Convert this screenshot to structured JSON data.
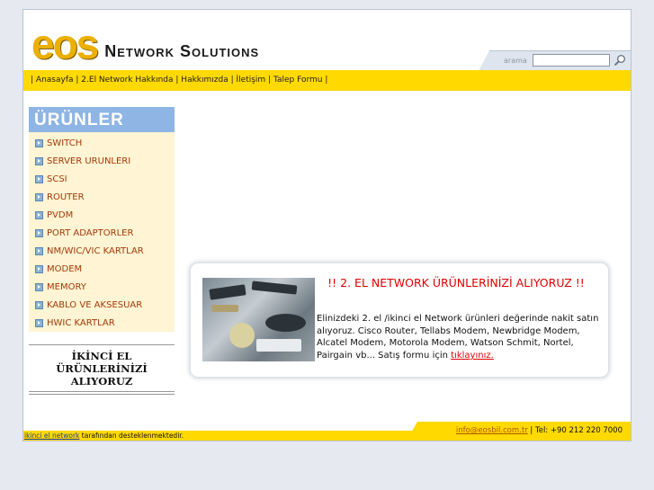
{
  "logo": {
    "primary": "eos",
    "secondary": "Network Solutions"
  },
  "search": {
    "label": "arama",
    "placeholder": "",
    "value": ""
  },
  "nav": {
    "separator_start": "|",
    "items": [
      "Anasayfa",
      "2.El Network Hakkında",
      "Hakkımızda",
      "İletişim",
      "Talep Formu"
    ],
    "separator": " | ",
    "separator_end": "|"
  },
  "sidebar": {
    "title": "ÜRÜNLER",
    "items": [
      "SWITCH",
      "SERVER URUNLERI",
      "SCSI",
      "ROUTER",
      "PVDM",
      "PORT ADAPTORLER",
      "NM/WIC/VIC KARTLAR",
      "MODEM",
      "MEMORY",
      "KABLO VE AKSESUAR",
      "HWIC KARTLAR"
    ],
    "promo": "İKİNCİ EL ÜRÜNLERİNİZİ ALIYORUZ"
  },
  "promo": {
    "heading": "!! 2. EL NETWORK ÜRÜNLERİNİZİ ALIYORUZ !!",
    "text": "Elinizdeki 2. el /ikinci el Network ürünleri değerinde nakit satın alıyoruz. Cisco Router, Tellabs Modem, Newbridge Modem, Alcatel Modem, Motorola Modem, Watson Schmit, Nortel, Pairgain vb... Satış formu için",
    "link": "tıklayınız."
  },
  "footer": {
    "email": "info@eosbil.com.tr",
    "phone_sep": "| Tel: +90 212 220 7000",
    "link": "ikinci el network",
    "tagline": "tarafından desteklenmektedir."
  },
  "colors": {
    "accent_yellow": "#ffd900",
    "sidebar_blue": "#8eb5e4",
    "menu_bg": "#fff4d3",
    "menu_text": "#a23a0a",
    "promo_red": "#e00000"
  }
}
